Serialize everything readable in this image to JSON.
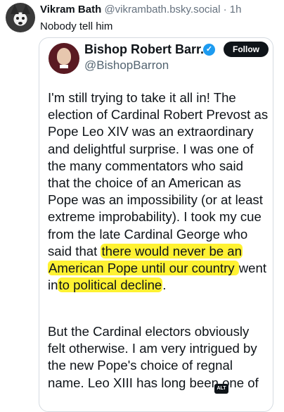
{
  "post": {
    "author_name": "Vikram Bath",
    "author_handle": "@vikrambath.bsky.social",
    "separator": "·",
    "time": "1h",
    "text": "Nobody tell him"
  },
  "embed": {
    "author_name": "Bishop Robert Barr...",
    "author_handle": "@BishopBarron",
    "follow_label": "Follow",
    "verified_icon": "✓",
    "paragraph1_lines": [
      "I'm still trying to take it all in!  The",
      "election of Cardinal Robert Prevost as",
      "Pope Leo XIV was an extraordinary",
      "and delightful surprise.  I was one of",
      "the many commentators who said",
      "that the choice of an American as",
      "Pope was an impossibility (or at least",
      "extreme improbability).  I took my cue",
      "from the late Cardinal George who"
    ],
    "line10_pre": "said that ",
    "line10_hl": "there would never be an",
    "line11_hl": "American Pope until our country ",
    "line11_post": "went",
    "line12_pre": "in",
    "line12_hl": "to political decline",
    "line12_post": ".",
    "paragraph2_lines": [
      "But the Cardinal electors obviously",
      "felt otherwise. I am very intrigued by",
      "the new Pope's choice of regnal",
      "name.  Leo XIII has long been one of"
    ],
    "alt_label": "ALT"
  },
  "colors": {
    "highlight": "#fff233",
    "verified": "#1d9bf0",
    "muted": "#536471"
  }
}
